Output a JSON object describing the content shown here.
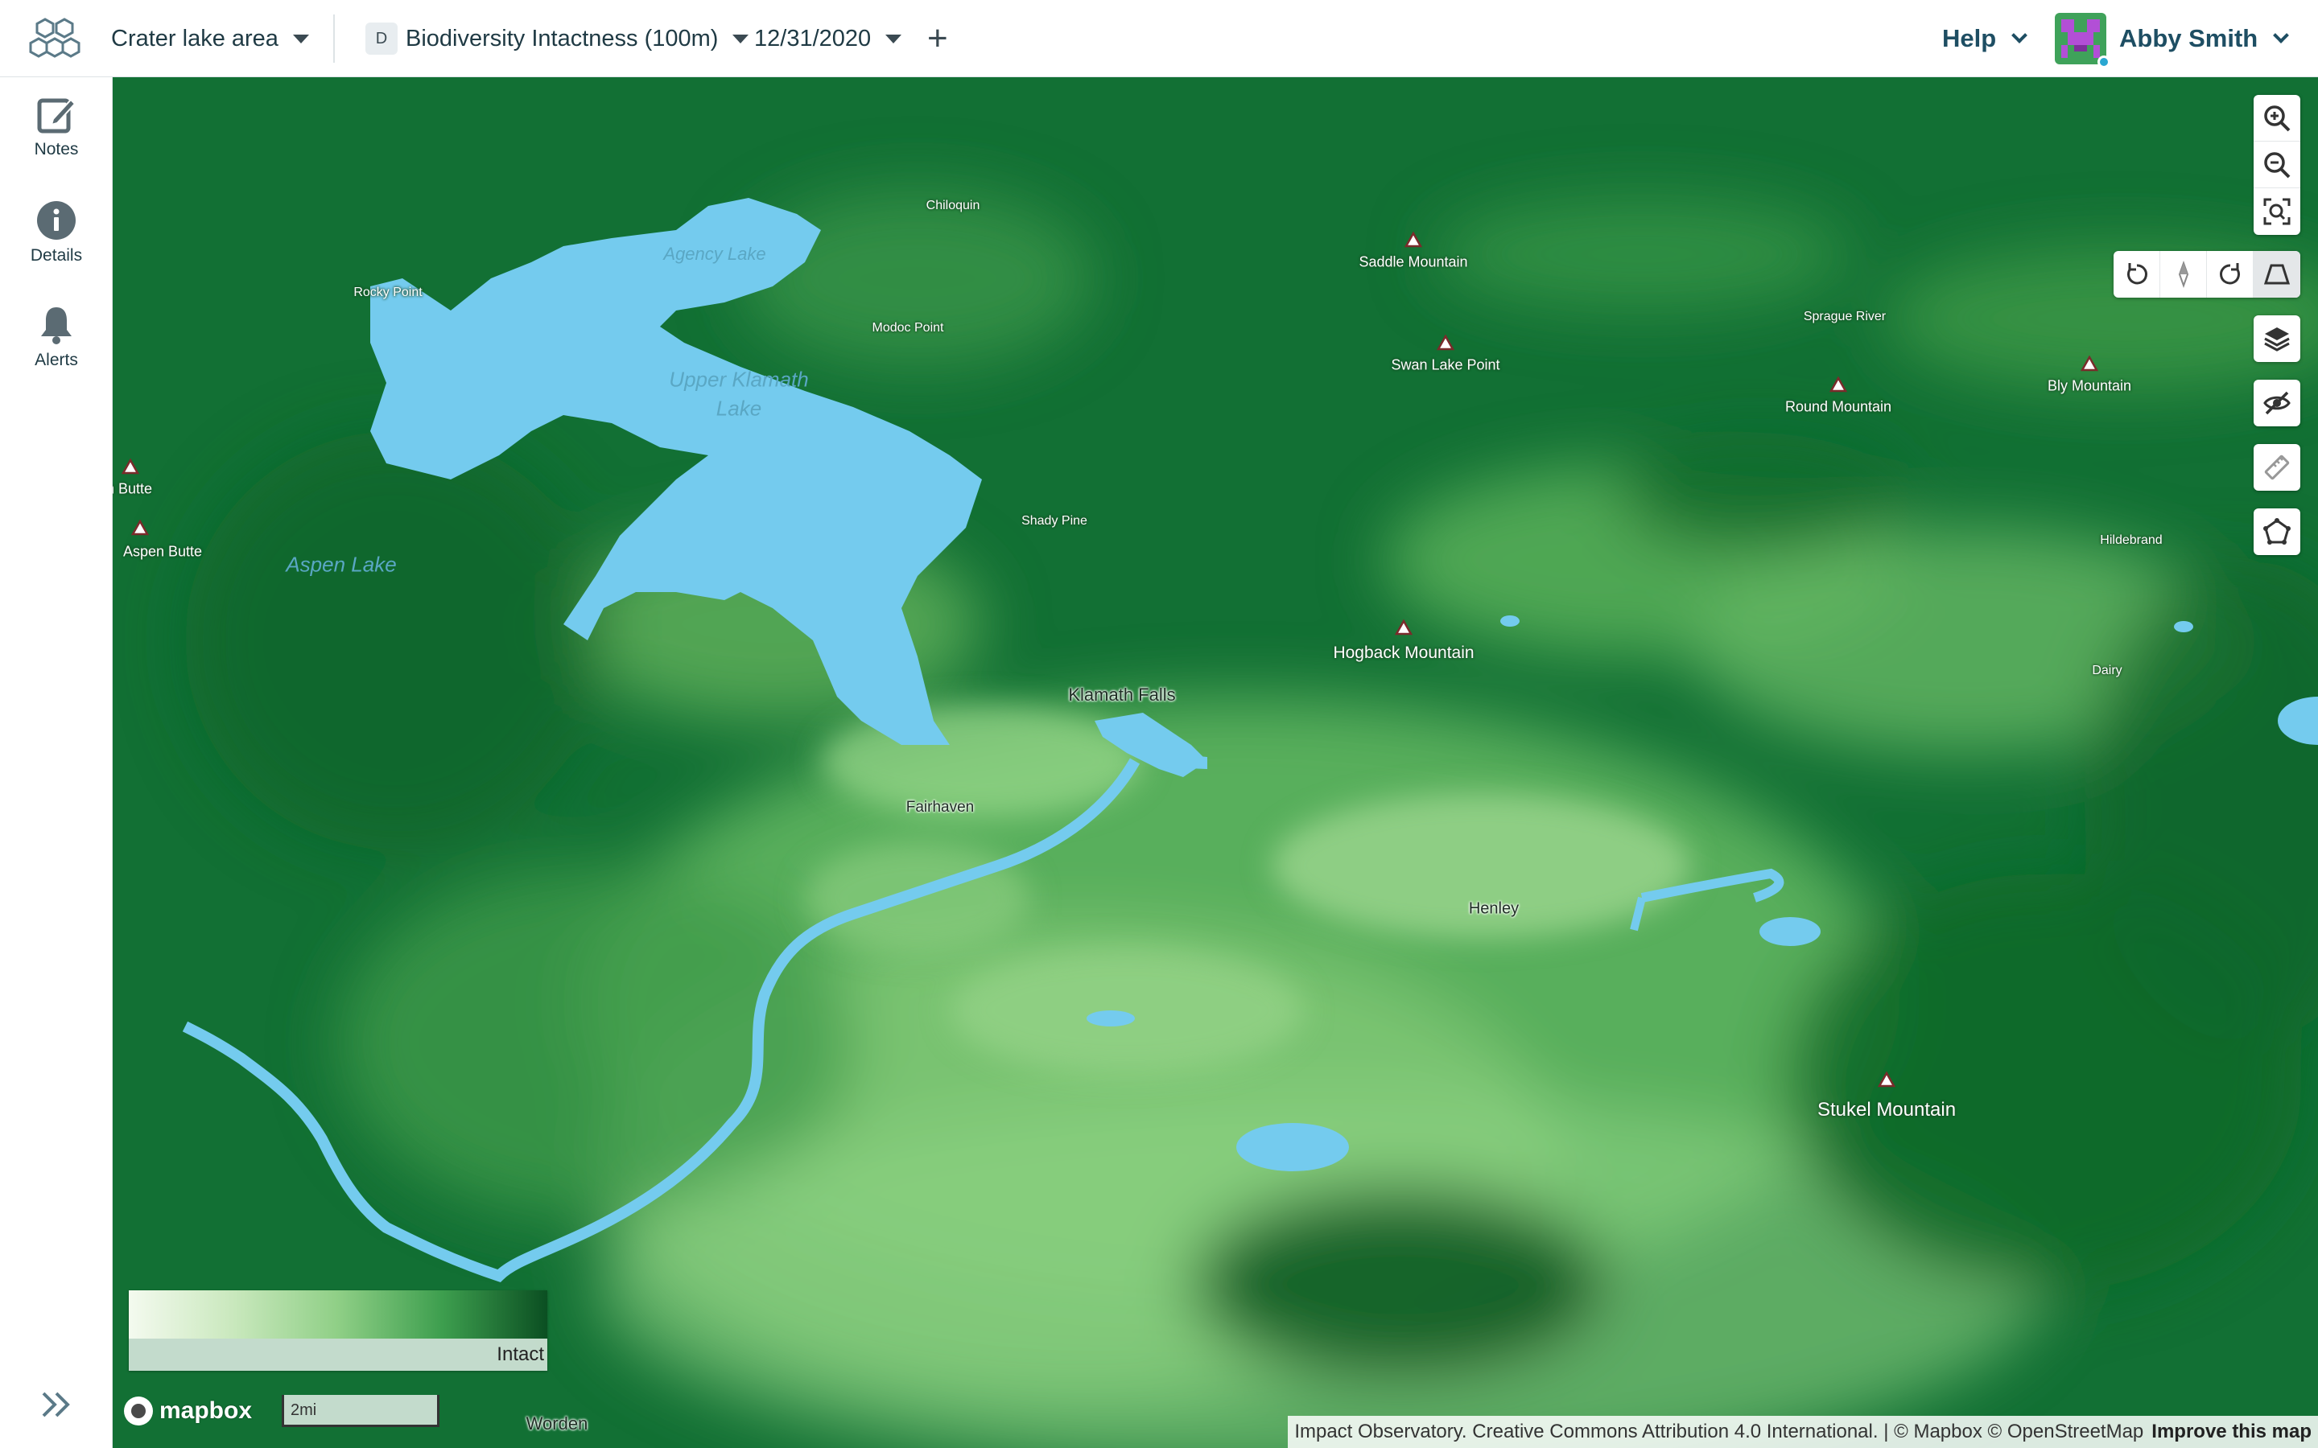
{
  "header": {
    "area": {
      "label": "Crater lake area",
      "icon": "chevron-down-icon"
    },
    "dataset": {
      "badge": "D",
      "label": "Biodiversity Intactness (100m)"
    },
    "date": {
      "label": "12/31/2020"
    },
    "add_label": "+",
    "help_label": "Help",
    "user": {
      "name": "Abby Smith",
      "status_color": "#2aa7d1"
    }
  },
  "sidebar": {
    "items": [
      {
        "label": "Notes",
        "icon": "edit-note-icon"
      },
      {
        "label": "Details",
        "icon": "info-icon"
      },
      {
        "label": "Alerts",
        "icon": "bell-icon"
      }
    ],
    "expand_icon": "double-chevron-right-icon"
  },
  "map": {
    "labels": {
      "chiloquin": "Chiloquin",
      "agency_lake": "Agency Lake",
      "rocky_point": "Rocky Point",
      "modoc_point": "Modoc Point",
      "upper_klamath_1": "Upper Klamath",
      "upper_klamath_2": "Lake",
      "shady_pine": "Shady Pine",
      "en_butte": "en Butte",
      "aspen_butte": "Aspen Butte",
      "aspen_lake": "Aspen Lake",
      "saddle_mountain": "Saddle Mountain",
      "swan_lake_point": "Swan Lake Point",
      "sprague_river": "Sprague River",
      "round_mountain": "Round Mountain",
      "bly_mountain": "Bly Mountain",
      "hildebrand": "Hildebrand",
      "hogback_mountain": "Hogback Mountain",
      "dairy": "Dairy",
      "klamath_falls": "Klamath Falls",
      "fairhaven": "Fairhaven",
      "henley": "Henley",
      "stukel_mountain": "Stukel Mountain",
      "worden": "Worden"
    },
    "colors": {
      "water": "#74cbee",
      "dark_green": "#0f6a2b",
      "light_green": "#8fd384"
    },
    "legend": {
      "end_label": "Intact"
    },
    "scale_label": "2mi",
    "mapbox_label": "mapbox",
    "attribution": "Impact Observatory. Creative Commons Attribution 4.0 International. | © Mapbox © OpenStreetMap",
    "improve_label": "Improve this map"
  },
  "controls": {
    "zoom_in_icon": "zoom-in-icon",
    "zoom_out_icon": "zoom-out-icon",
    "fit_icon": "fit-bounds-icon",
    "rotate_left_icon": "rotate-left-icon",
    "compass_icon": "compass-icon",
    "rotate_right_icon": "rotate-right-icon",
    "pitch_icon": "3d-pitch-icon",
    "layers_icon": "layers-icon",
    "visibility_icon": "eye-off-icon",
    "measure_icon": "ruler-icon",
    "draw_icon": "polygon-draw-icon"
  }
}
